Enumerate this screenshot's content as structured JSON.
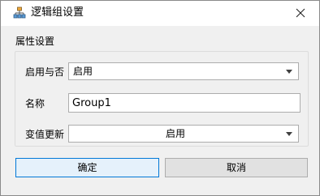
{
  "window": {
    "title": "逻辑组设置",
    "icon": "org-chart-icon",
    "close_icon": "close-icon"
  },
  "group": {
    "title": "属性设置",
    "enable": {
      "label": "启用与否",
      "selected": "启用"
    },
    "name": {
      "label": "名称",
      "value": "Group1"
    },
    "update": {
      "label": "变值更新",
      "selected": "启用"
    }
  },
  "buttons": {
    "ok": "确定",
    "cancel": "取消"
  },
  "colors": {
    "focus_border": "#0078d7",
    "background": "#f0f0f0",
    "field_border": "#adadad"
  }
}
